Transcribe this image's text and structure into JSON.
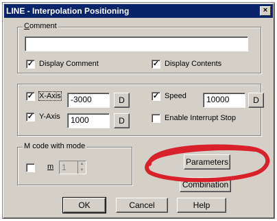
{
  "dialog": {
    "title": "LINE - Interpolation Positioning",
    "close_glyph": "×"
  },
  "comment_group": {
    "label": "Comment",
    "value": "",
    "display_comment": {
      "label": "Display Comment",
      "checked": true
    },
    "display_contents": {
      "label": "Display Contents",
      "checked": true
    }
  },
  "axis_group": {
    "x_axis": {
      "label": "X-Axis",
      "checked": true,
      "value": "-3000",
      "button": "D"
    },
    "y_axis": {
      "label": "Y-Axis",
      "checked": true,
      "value": "1000",
      "button": "D"
    },
    "speed": {
      "label": "Speed",
      "checked": true,
      "value": "10000",
      "button": "D"
    },
    "interrupt": {
      "label": "Enable Interrupt Stop",
      "checked": false
    }
  },
  "mcode_group": {
    "label": "M code with mode",
    "m_label": "m",
    "m_checked": false,
    "m_value": "1"
  },
  "buttons": {
    "parameters": "Parameters",
    "combination": "Combination",
    "ok": "OK",
    "cancel": "Cancel",
    "help": "Help"
  },
  "annotation": {
    "color": "#d8212a"
  },
  "icons": {
    "checkmark": "check-icon",
    "close": "close-icon",
    "spin": "spin-arrows-icon"
  }
}
